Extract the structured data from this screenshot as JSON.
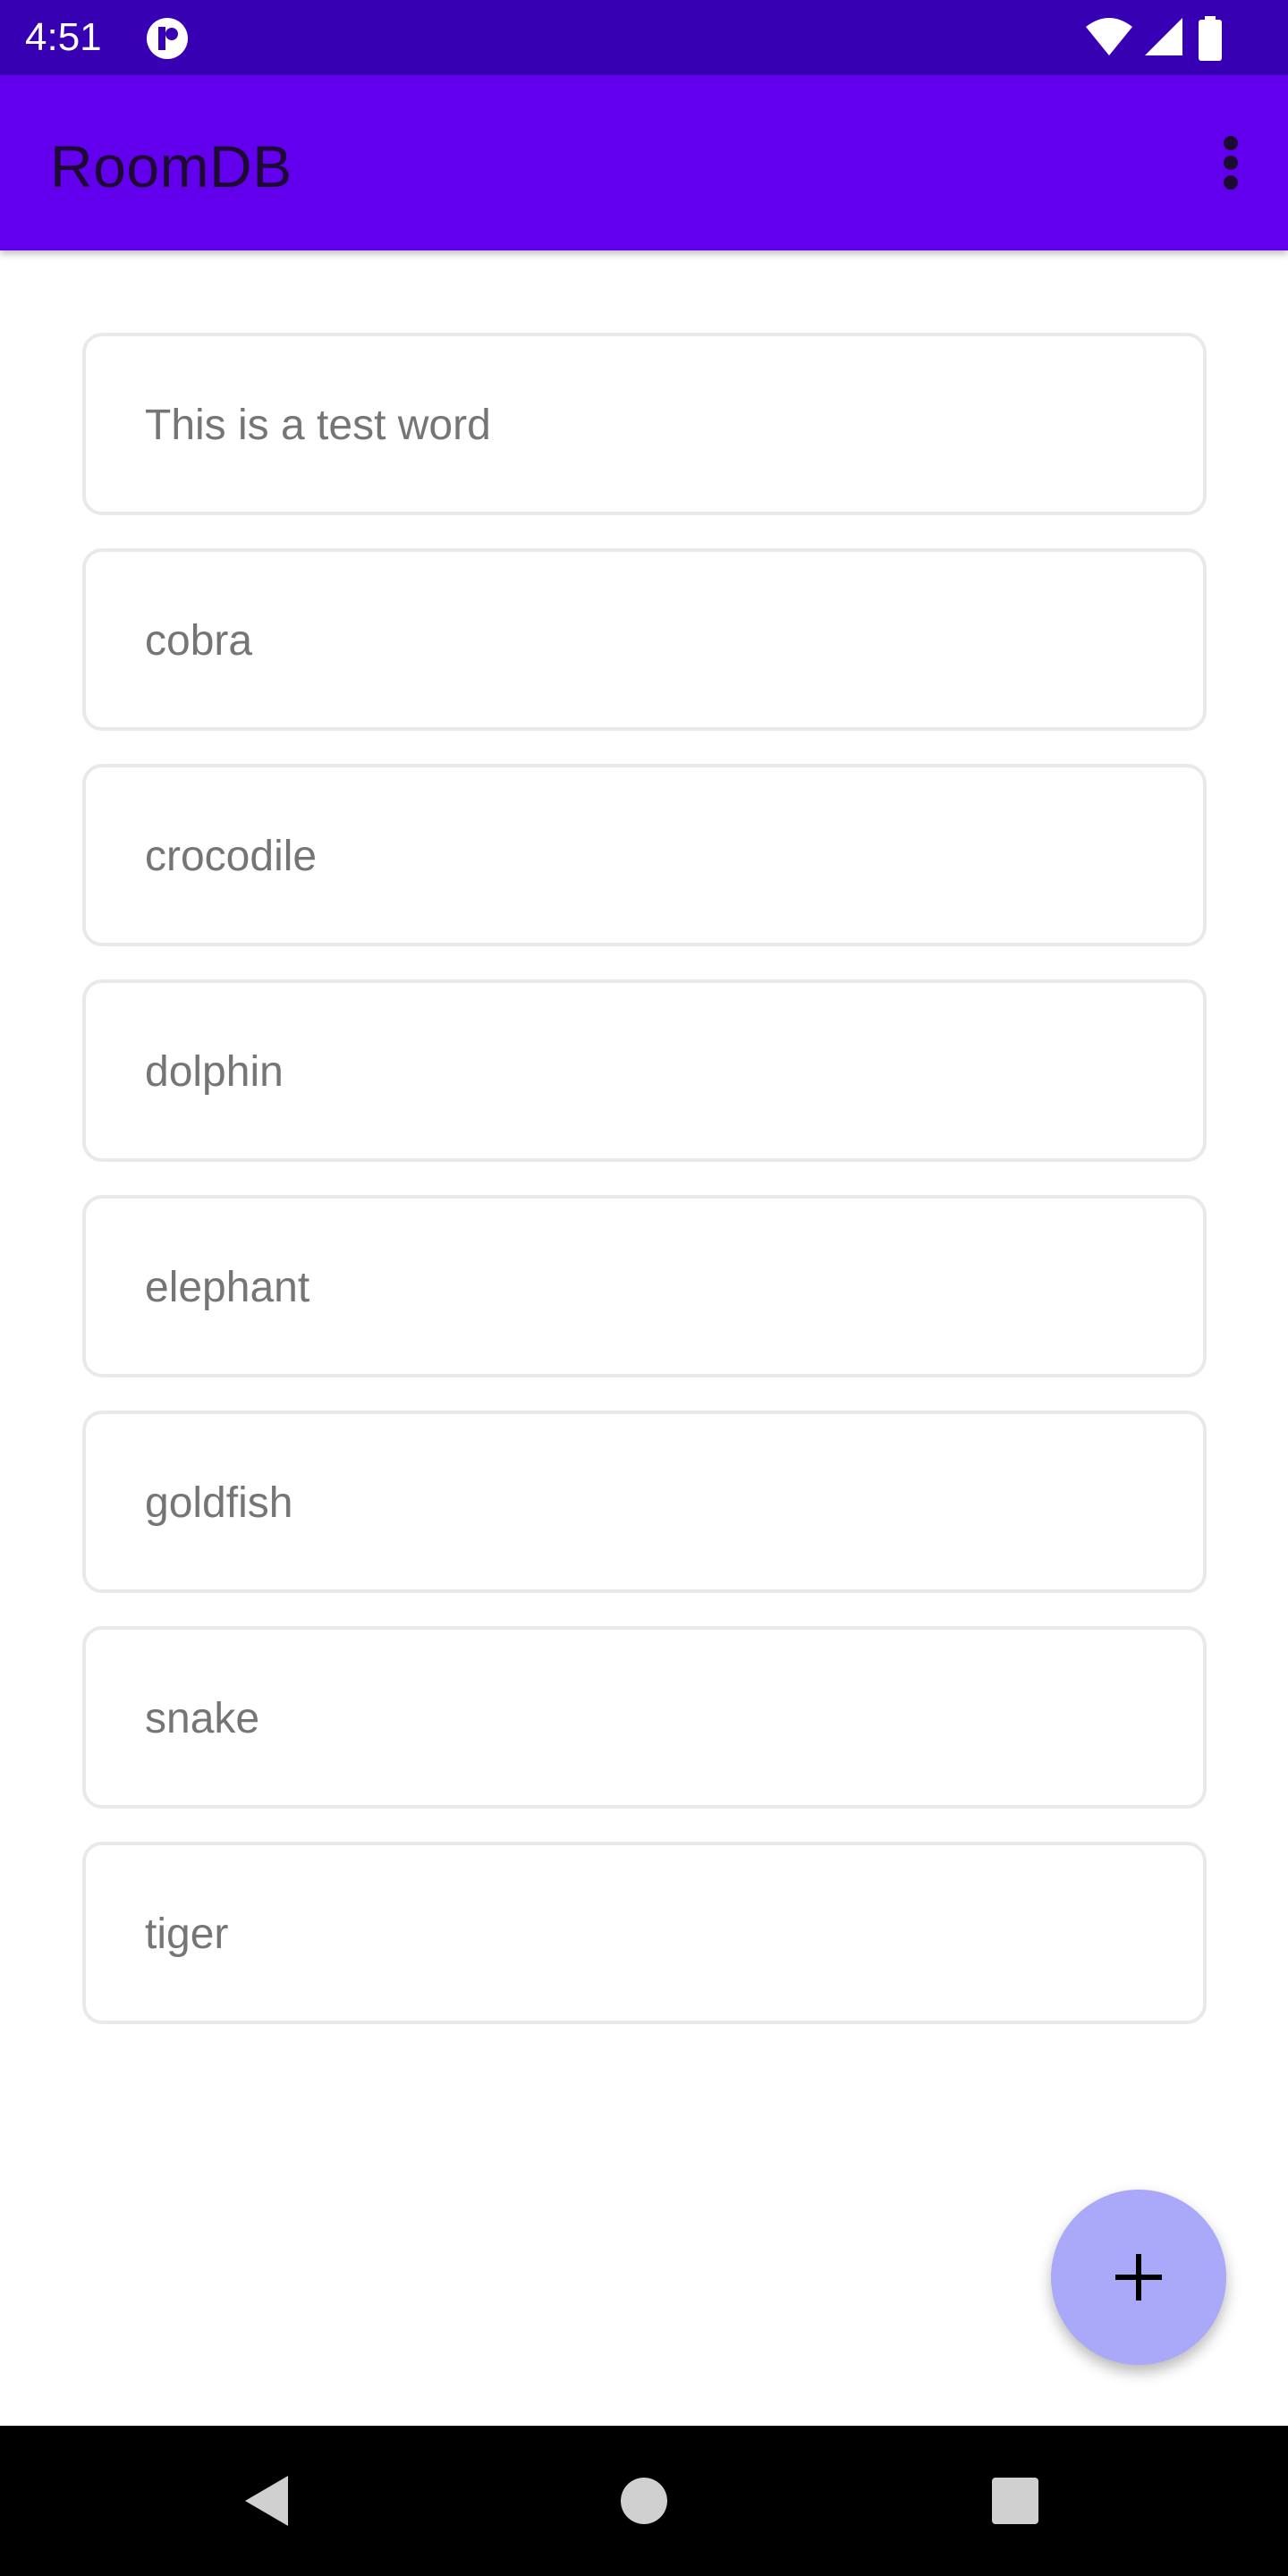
{
  "status_bar": {
    "time": "4:51",
    "icons": [
      "app-notification-icon",
      "wifi-icon",
      "signal-icon",
      "battery-icon"
    ]
  },
  "app_bar": {
    "title": "RoomDB",
    "menu_icon": "more-vert-icon"
  },
  "words": [
    "This is a test word",
    "cobra",
    "crocodile",
    "dolphin",
    "elephant",
    "goldfish",
    "snake",
    "tiger"
  ],
  "fab": {
    "icon": "add-icon"
  },
  "nav_bar": {
    "icons": [
      "back-icon",
      "home-icon",
      "recents-icon"
    ]
  },
  "colors": {
    "status_bar": "#3700b3",
    "app_bar": "#6200ee",
    "fab": "#aaa8f8",
    "item_text": "#757575"
  }
}
